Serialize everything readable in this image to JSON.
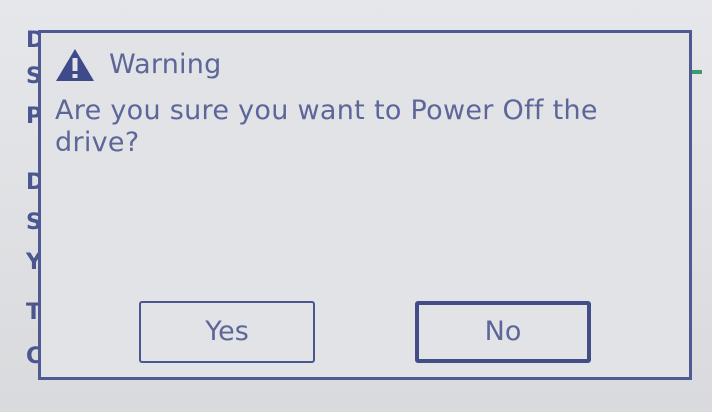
{
  "dialog": {
    "title": "Warning",
    "message": "Are you sure you want to Power Off the drive?",
    "icon": "warning-icon"
  },
  "buttons": {
    "yes_label": "Yes",
    "no_label": "No"
  },
  "colors": {
    "text": "#5d6698",
    "border": "#505a92",
    "background": "#e2e3e6"
  }
}
